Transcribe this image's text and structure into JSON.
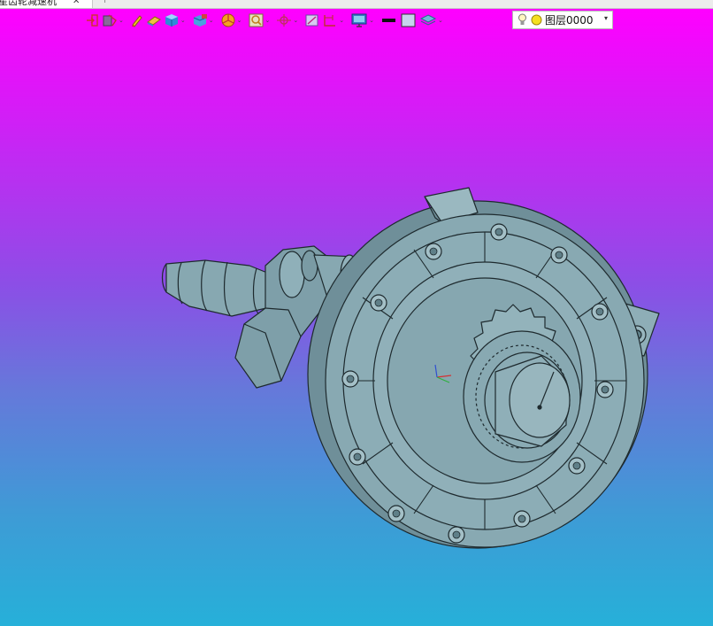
{
  "document_tab": {
    "title": "星齿轮减速机",
    "close_glyph": "✕",
    "new_tab_glyph": "+"
  },
  "toolbar": {
    "buttons": [
      {
        "name": "exit-sketch-button",
        "icon": "exit-arrow-icon",
        "dropdown": false
      },
      {
        "name": "measure-button",
        "icon": "measure-icon",
        "dropdown": true
      },
      {
        "name": "pen-button",
        "icon": "pen-icon",
        "dropdown": false
      },
      {
        "name": "eraser-button",
        "icon": "eraser-icon",
        "dropdown": false
      },
      {
        "name": "shaded-view-button",
        "icon": "shaded-cube-icon",
        "dropdown": true
      },
      {
        "name": "view-orientation-button",
        "icon": "view-cube-icon",
        "dropdown": true
      },
      {
        "name": "appearance-button",
        "icon": "color-wheel-icon",
        "dropdown": true
      },
      {
        "name": "zoom-button",
        "icon": "zoom-icon",
        "dropdown": true
      },
      {
        "name": "triad-button",
        "icon": "triad-icon",
        "dropdown": true
      },
      {
        "name": "section-view-button",
        "icon": "section-icon",
        "dropdown": false
      },
      {
        "name": "dimension-button",
        "icon": "dimension-icon",
        "dropdown": true
      },
      {
        "name": "display-settings-button",
        "icon": "monitor-icon",
        "dropdown": true
      },
      {
        "name": "line-color-button",
        "icon": "line-color-icon",
        "dropdown": false
      },
      {
        "name": "fill-color-button",
        "icon": "fill-color-icon",
        "dropdown": false
      },
      {
        "name": "layer-tool-button",
        "icon": "layers-icon",
        "dropdown": true
      }
    ],
    "dropdown_glyph": "⌄"
  },
  "layer": {
    "current": "图层0000",
    "caret": "▾",
    "icons": [
      "light-bulb-icon",
      "sun-icon"
    ]
  },
  "colors": {
    "viewport_top": "#ff00ff",
    "viewport_bottom": "#26b0d9",
    "model_face": "#86a7b0",
    "model_edge": "#1e2a2e"
  }
}
